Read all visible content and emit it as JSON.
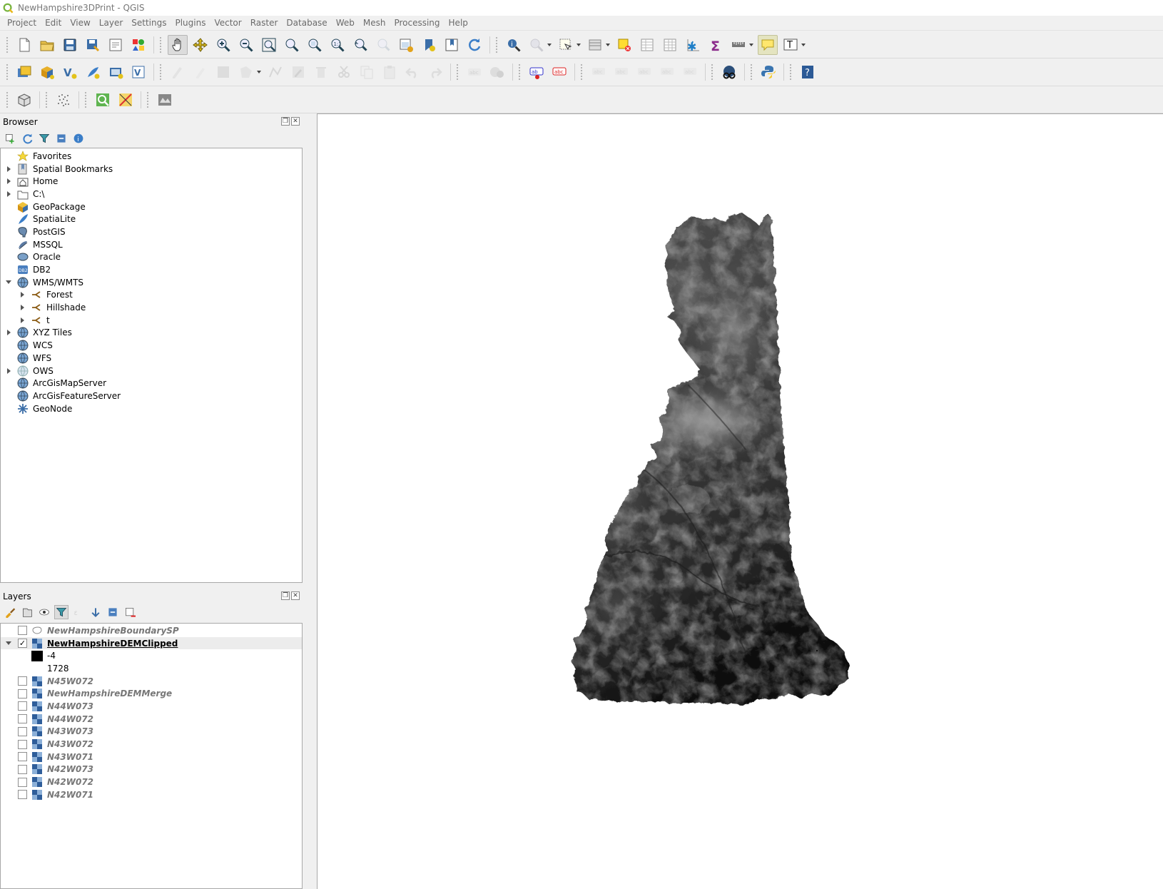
{
  "window": {
    "title": "NewHampshire3DPrint - QGIS",
    "app_icon": "qgis-logo-icon"
  },
  "menubar": {
    "items": [
      "Project",
      "Edit",
      "View",
      "Layer",
      "Settings",
      "Plugins",
      "Vector",
      "Raster",
      "Database",
      "Web",
      "Mesh",
      "Processing",
      "Help"
    ]
  },
  "toolbars": {
    "row1": [
      "new-project-icon",
      "open-project-icon",
      "save-project-icon",
      "save-as-icon",
      "print-layout-icon",
      "style-manager-icon",
      "pan-icon",
      "pan-to-selection-icon",
      "zoom-in-icon",
      "zoom-out-icon",
      "zoom-full-icon",
      "zoom-to-selection-icon",
      "zoom-to-layer-icon",
      "zoom-native-icon",
      "zoom-last-icon",
      "zoom-next-icon",
      "new-map-view-icon",
      "new-bookmark-icon",
      "show-bookmarks-icon",
      "refresh-icon",
      "identify-icon",
      "run-feature-action-icon",
      "select-features-icon",
      "select-by-value-icon",
      "deselect-all-icon",
      "attribute-table-icon",
      "field-calculator-icon",
      "statistics-icon",
      "statistical-summary-icon",
      "measure-icon",
      "map-tips-icon",
      "text-annotation-icon"
    ],
    "row2": [
      "data-source-manager-icon",
      "new-geopackage-layer-icon",
      "new-shapefile-layer-icon",
      "new-spatialite-layer-icon",
      "new-virtual-layer-icon",
      "new-temporary-layer-icon",
      "current-edits-icon",
      "toggle-editing-icon",
      "save-edits-icon",
      "add-feature-icon",
      "vertex-tool-icon",
      "modify-attributes-icon",
      "delete-selected-icon",
      "cut-features-icon",
      "copy-features-icon",
      "paste-features-icon",
      "undo-icon",
      "redo-icon",
      "label-toolbar-icon",
      "layer-labeling-icon",
      "layer-diagram-icon",
      "highlight-pinned-labels-icon",
      "pin-labels-icon",
      "show-hide-labels-icon",
      "move-label-icon",
      "rotate-label-icon",
      "change-label-icon",
      "metasearch-icon",
      "python-console-icon",
      "help-icon"
    ],
    "row3": [
      "3d-map-view-icon",
      "point-cloud-icon",
      "processing-toolbox-icon",
      "georeferencer-icon",
      "raster-calculator-icon"
    ]
  },
  "browser_panel": {
    "title": "Browser",
    "tools": [
      "add-selected-icon",
      "refresh-icon",
      "filter-icon",
      "collapse-all-icon",
      "properties-icon"
    ],
    "items": [
      {
        "label": "Favorites",
        "icon": "star-icon",
        "expander": "none",
        "depth": 0
      },
      {
        "label": "Spatial Bookmarks",
        "icon": "bookmark-icon",
        "expander": "right",
        "depth": 0
      },
      {
        "label": "Home",
        "icon": "home-folder-icon",
        "expander": "right",
        "depth": 0
      },
      {
        "label": "C:\\",
        "icon": "drive-folder-icon",
        "expander": "right",
        "depth": 0
      },
      {
        "label": "GeoPackage",
        "icon": "geopackage-icon",
        "expander": "none",
        "depth": 0
      },
      {
        "label": "SpatiaLite",
        "icon": "spatialite-icon",
        "expander": "none",
        "depth": 0
      },
      {
        "label": "PostGIS",
        "icon": "postgis-elephant-icon",
        "expander": "none",
        "depth": 0
      },
      {
        "label": "MSSQL",
        "icon": "mssql-icon",
        "expander": "none",
        "depth": 0
      },
      {
        "label": "Oracle",
        "icon": "oracle-icon",
        "expander": "none",
        "depth": 0
      },
      {
        "label": "DB2",
        "icon": "db2-icon",
        "expander": "none",
        "depth": 0
      },
      {
        "label": "WMS/WMTS",
        "icon": "globe-icon",
        "expander": "down",
        "depth": 0
      },
      {
        "label": "Forest",
        "icon": "wms-connection-icon",
        "expander": "right",
        "depth": 1
      },
      {
        "label": "Hillshade",
        "icon": "wms-connection-icon",
        "expander": "right",
        "depth": 1
      },
      {
        "label": "t",
        "icon": "wms-connection-icon",
        "expander": "right",
        "depth": 1
      },
      {
        "label": "XYZ Tiles",
        "icon": "globe-icon",
        "expander": "right",
        "depth": 0
      },
      {
        "label": "WCS",
        "icon": "globe-icon",
        "expander": "none",
        "depth": 0
      },
      {
        "label": "WFS",
        "icon": "globe-icon",
        "expander": "none",
        "depth": 0
      },
      {
        "label": "OWS",
        "icon": "globe-light-icon",
        "expander": "right",
        "depth": 0
      },
      {
        "label": "ArcGisMapServer",
        "icon": "globe-icon",
        "expander": "none",
        "depth": 0
      },
      {
        "label": "ArcGisFeatureServer",
        "icon": "globe-icon",
        "expander": "none",
        "depth": 0
      },
      {
        "label": "GeoNode",
        "icon": "geonode-icon",
        "expander": "none",
        "depth": 0
      }
    ]
  },
  "layers_panel": {
    "title": "Layers",
    "tools": [
      "style-brush-icon",
      "add-group-icon",
      "manage-visibility-icon",
      "filter-legend-icon",
      "filter-expression-icon",
      "expand-all-icon",
      "collapse-all-icon",
      "remove-layer-icon"
    ],
    "layers": [
      {
        "name": "NewHampshireBoundarySP",
        "type": "polygon",
        "checked": false,
        "active": false
      },
      {
        "name": "NewHampshireDEMClipped",
        "type": "raster",
        "checked": true,
        "active": true,
        "legend": {
          "min": "-4",
          "max": "1728"
        }
      },
      {
        "name": "N45W072",
        "type": "raster",
        "checked": false,
        "active": false
      },
      {
        "name": "NewHampshireDEMMerge",
        "type": "raster",
        "checked": false,
        "active": false
      },
      {
        "name": "N44W073",
        "type": "raster",
        "checked": false,
        "active": false
      },
      {
        "name": "N44W072",
        "type": "raster",
        "checked": false,
        "active": false
      },
      {
        "name": "N43W073",
        "type": "raster",
        "checked": false,
        "active": false
      },
      {
        "name": "N43W072",
        "type": "raster",
        "checked": false,
        "active": false
      },
      {
        "name": "N43W071",
        "type": "raster",
        "checked": false,
        "active": false
      },
      {
        "name": "N42W073",
        "type": "raster",
        "checked": false,
        "active": false
      },
      {
        "name": "N42W072",
        "type": "raster",
        "checked": false,
        "active": false
      },
      {
        "name": "N42W071",
        "type": "raster",
        "checked": false,
        "active": false
      }
    ]
  },
  "map_canvas": {
    "content": "grayscale-dem-new-hampshire",
    "background": "#ffffff"
  }
}
